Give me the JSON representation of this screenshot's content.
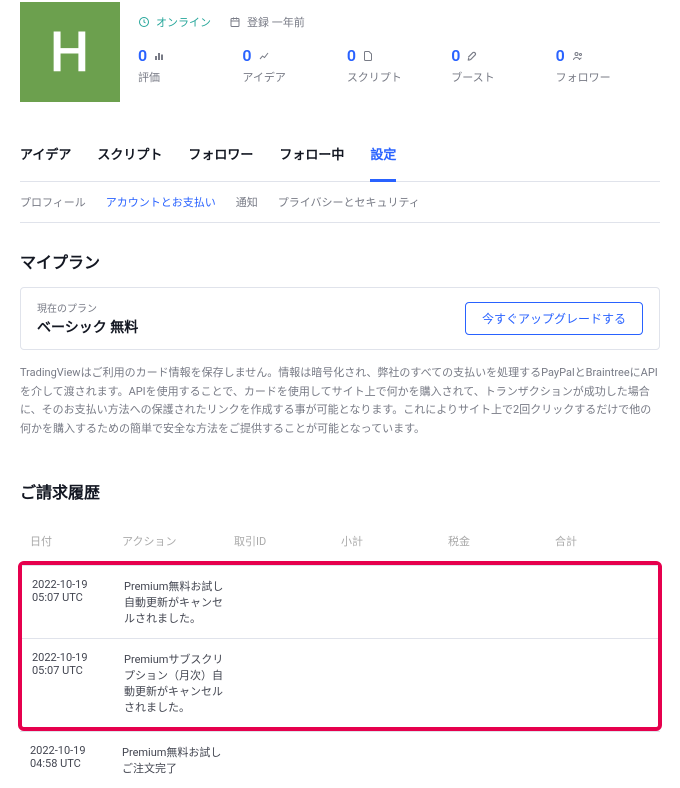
{
  "avatar": {
    "initial": "H"
  },
  "status": {
    "online": "オンライン",
    "registered_label": "登録 一年前"
  },
  "stats": {
    "rating": {
      "value": "0",
      "label": "評価"
    },
    "ideas": {
      "value": "0",
      "label": "アイデア"
    },
    "scripts": {
      "value": "0",
      "label": "スクリプト"
    },
    "boosts": {
      "value": "0",
      "label": "ブースト"
    },
    "followers": {
      "value": "0",
      "label": "フォロワー"
    }
  },
  "main_tabs": {
    "ideas": "アイデア",
    "scripts": "スクリプト",
    "followers": "フォロワー",
    "following": "フォロー中",
    "settings": "設定"
  },
  "sub_tabs": {
    "profile": "プロフィール",
    "account": "アカウントとお支払い",
    "notifications": "通知",
    "privacy": "プライバシーとセキュリティ"
  },
  "plan_section": {
    "title": "マイプラン",
    "current_label": "現在のプラン",
    "name": "ベーシック 無料",
    "upgrade_btn": "今すぐアップグレードする",
    "description": "TradingViewはご利用のカード情報を保存しません。情報は暗号化され、弊社のすべての支払いを処理するPayPalとBraintreeにAPIを介して渡されます。APIを使用することで、カードを使用してサイト上で何かを購入されて、トランザクションが成功した場合に、そのお支払い方法への保護されたリンクを作成する事が可能となります。これによりサイト上で2回クリックするだけで他の何かを購入するための簡単で安全な方法をご提供することが可能となっています。"
  },
  "billing": {
    "title": "ご請求履歴",
    "headers": {
      "date": "日付",
      "action": "アクション",
      "transaction_id": "取引ID",
      "subtotal": "小計",
      "tax": "税金",
      "total": "合計"
    },
    "rows": [
      {
        "date": "2022-10-19 05:07 UTC",
        "action": "Premium無料お試し 自動更新がキャンセルされました。"
      },
      {
        "date": "2022-10-19 05:07 UTC",
        "action": "Premiumサブスクリプション（月次）自動更新がキャンセルされました。"
      },
      {
        "date": "2022-10-19 04:58 UTC",
        "action": "Premium無料お試し ご注文完了"
      }
    ]
  }
}
